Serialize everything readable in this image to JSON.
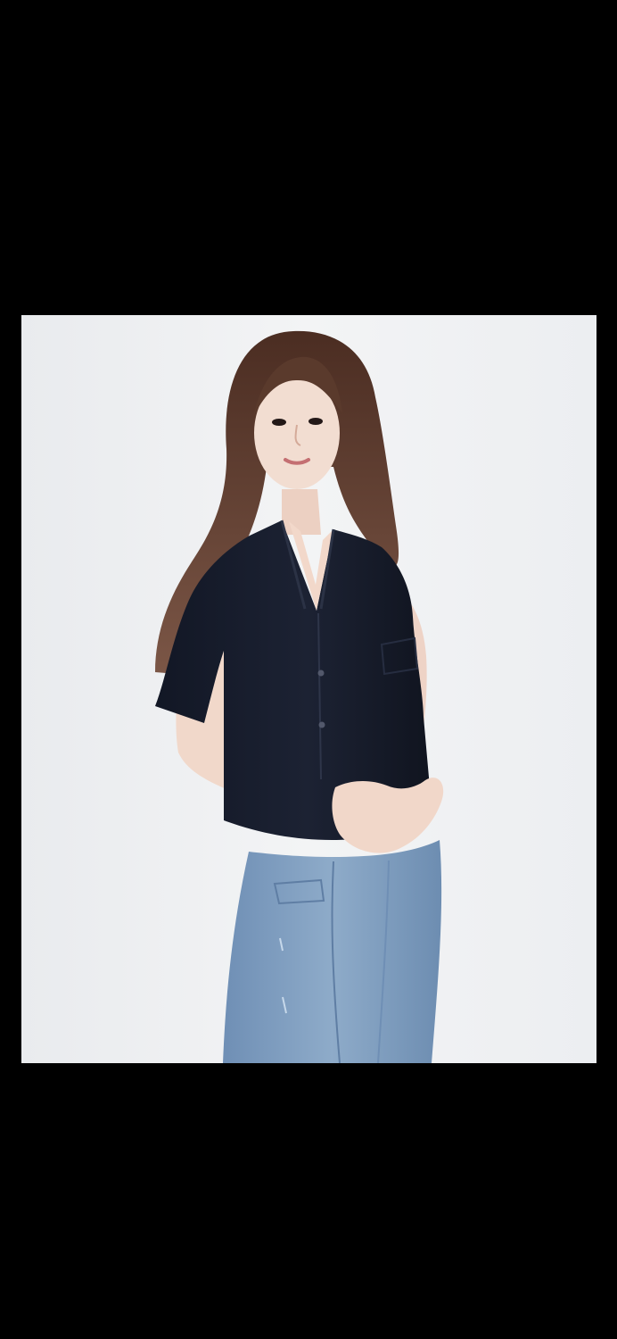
{
  "viewer": {
    "background_color": "#000000"
  },
  "photo": {
    "subject_description": "woman-in-navy-short-sleeve-shirt-and-light-wash-jeans",
    "backdrop_color": "#eff0f2",
    "shirt_color": "#151a27",
    "jeans_color": "#7d9bbd",
    "hair_color": "#5a3a2c",
    "skin_color": "#f1d9cc"
  }
}
